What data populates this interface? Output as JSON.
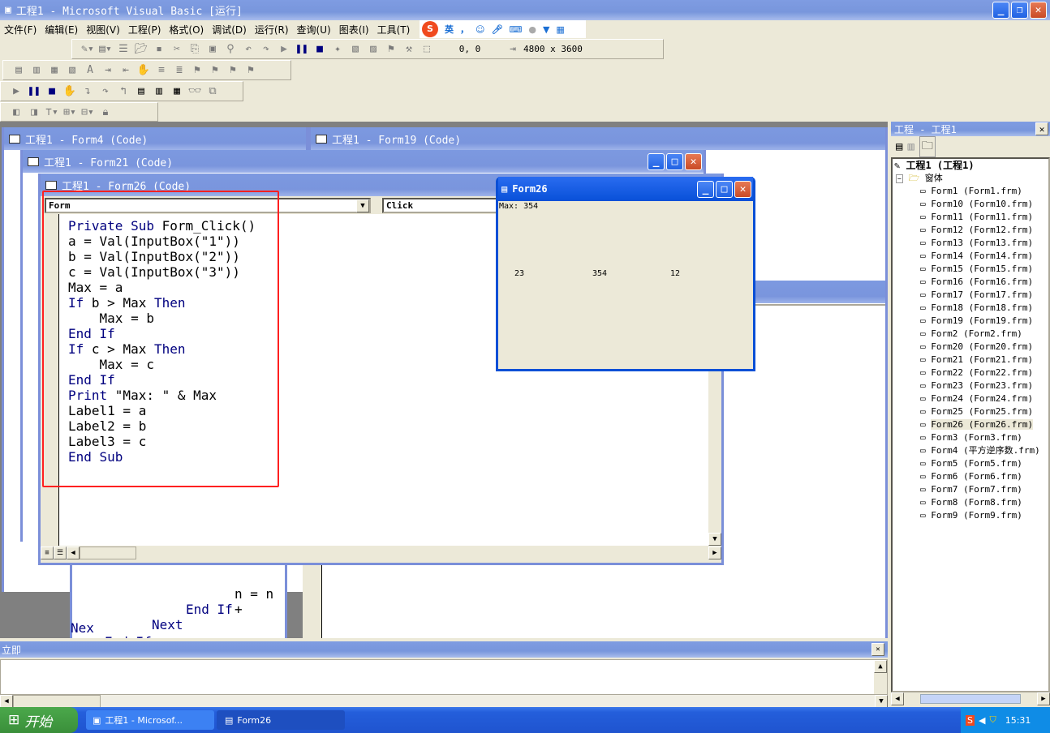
{
  "app": {
    "title": "工程1 - Microsoft Visual Basic [运行]"
  },
  "menu": [
    "文件(F)",
    "编辑(E)",
    "视图(V)",
    "工程(P)",
    "格式(O)",
    "调试(D)",
    "运行(R)",
    "查询(U)",
    "图表(I)",
    "工具(T)"
  ],
  "ime": {
    "logo": "S",
    "lang": "英",
    "punct": "，"
  },
  "toolbar": {
    "position": "0, 0",
    "size": "4800 x 3600"
  },
  "code_windows": {
    "form4": "工程1 - Form4 (Code)",
    "form19": "工程1 - Form19 (Code)",
    "form21": "工程1 - Form21 (Code)",
    "form26": "工程1 - Form26 (Code)"
  },
  "form26_code": {
    "object": "Form",
    "procedure": "Click",
    "lines": [
      [
        [
          "Private Sub ",
          1
        ],
        [
          "Form_Click()",
          0
        ]
      ],
      [
        [
          "a = Val(InputBox(\"1\"))",
          0
        ]
      ],
      [
        [
          "b = Val(InputBox(\"2\"))",
          0
        ]
      ],
      [
        [
          "c = Val(InputBox(\"3\"))",
          0
        ]
      ],
      [
        [
          "Max = a",
          0
        ]
      ],
      [
        [
          "If ",
          1
        ],
        [
          "b > Max ",
          0
        ],
        [
          "Then",
          1
        ]
      ],
      [
        [
          "    Max = b",
          0
        ]
      ],
      [
        [
          "End If",
          1
        ]
      ],
      [
        [
          "If ",
          1
        ],
        [
          "c > Max ",
          0
        ],
        [
          "Then",
          1
        ]
      ],
      [
        [
          "    Max = c",
          0
        ]
      ],
      [
        [
          "End If",
          1
        ]
      ],
      [
        [
          "Print ",
          1
        ],
        [
          "\"Max: \" & Max",
          0
        ]
      ],
      [
        [
          "Label1 = a",
          0
        ]
      ],
      [
        [
          "Label2 = b",
          0
        ]
      ],
      [
        [
          "Label3 = c",
          0
        ]
      ],
      [
        [
          "End Sub",
          1
        ]
      ]
    ]
  },
  "background_code": [
    {
      "text": "n = n +",
      "kw": false
    },
    {
      "text": "End If",
      "kw": true
    },
    {
      "text": "Next",
      "kw": true
    },
    {
      "text": "Nex",
      "kw": true
    },
    {
      "text": "End If",
      "kw": true
    }
  ],
  "runtime_form": {
    "title": "Form26",
    "print_output": "Max: 354",
    "label1": "23",
    "label2": "354",
    "label3": "12"
  },
  "project": {
    "title": "工程 - 工程1",
    "root": "工程1 (工程1)",
    "folder": "窗体",
    "selected": "Form26 (Form26.frm)",
    "items": [
      "Form1 (Form1.frm)",
      "Form10 (Form10.frm)",
      "Form11 (Form11.frm)",
      "Form12 (Form12.frm)",
      "Form13 (Form13.frm)",
      "Form14 (Form14.frm)",
      "Form15 (Form15.frm)",
      "Form16 (Form16.frm)",
      "Form17 (Form17.frm)",
      "Form18 (Form18.frm)",
      "Form19 (Form19.frm)",
      "Form2 (Form2.frm)",
      "Form20 (Form20.frm)",
      "Form21 (Form21.frm)",
      "Form22 (Form22.frm)",
      "Form23 (Form23.frm)",
      "Form24 (Form24.frm)",
      "Form25 (Form25.frm)",
      "Form26 (Form26.frm)",
      "Form3 (Form3.frm)",
      "Form4 (平方逆序数.frm)",
      "Form5 (Form5.frm)",
      "Form6 (Form6.frm)",
      "Form7 (Form7.frm)",
      "Form8 (Form8.frm)",
      "Form9 (Form9.frm)"
    ]
  },
  "immediate": {
    "title": "立即"
  },
  "taskbar": {
    "start": "开始",
    "tasks": [
      "工程1 - Microsof...",
      "Form26"
    ],
    "clock": "15:31"
  },
  "colors": {
    "highlight": "#ff0000",
    "keyword": "#00007f",
    "taskbar": "#245edb"
  }
}
